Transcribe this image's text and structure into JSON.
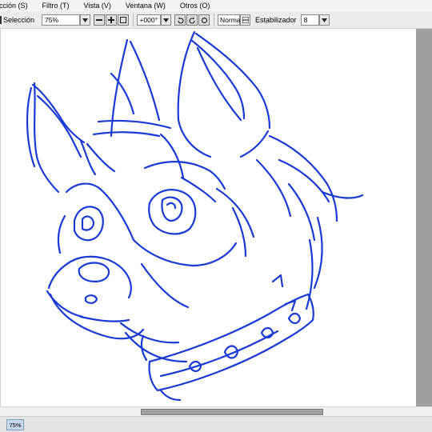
{
  "menu": [
    {
      "label": "ección (S)"
    },
    {
      "label": "Filtro (T)"
    },
    {
      "label": "Vista (V)"
    },
    {
      "label": "Ventana (W)"
    },
    {
      "label": "Otros (O)"
    }
  ],
  "toolbar": {
    "selection_label": "Selección",
    "zoom_value": "75%",
    "rotation_value": "+000°",
    "blend_mode": "Normal",
    "stabilizer_label": "Estabilizador",
    "stabilizer_value": "8"
  },
  "status": {
    "zoom": "75%"
  },
  "sketch": {
    "stroke_color": "#1a3ad6",
    "subject": "canine head with spiked collar"
  }
}
